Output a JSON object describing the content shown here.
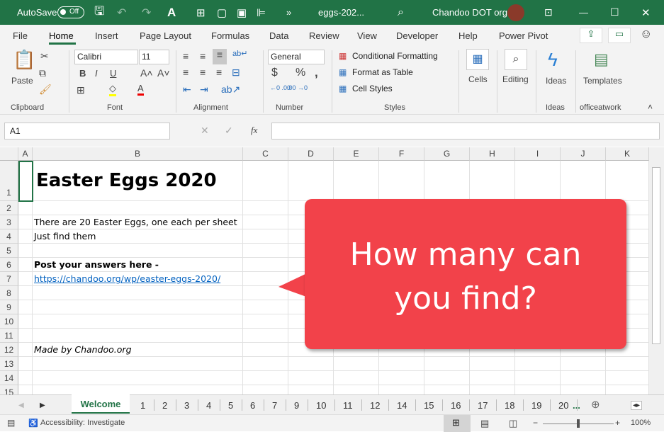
{
  "titlebar": {
    "autosave": "AutoSave",
    "toggle": "Off",
    "filename": "eggs-202...",
    "user": "Chandoo DOT org"
  },
  "menu": [
    "File",
    "Home",
    "Insert",
    "Page Layout",
    "Formulas",
    "Data",
    "Review",
    "View",
    "Developer",
    "Help",
    "Power Pivot"
  ],
  "ribbon": {
    "paste": "Paste",
    "font": "Calibri",
    "size": "11",
    "number_format": "General",
    "cond": "Conditional Formatting",
    "table": "Format as Table",
    "styles": "Cell Styles",
    "cells": "Cells",
    "editing": "Editing",
    "ideas": "Ideas",
    "templates": "Templates",
    "groups": [
      "Clipboard",
      "Font",
      "Alignment",
      "Number",
      "Styles",
      "Ideas",
      "officeatwork"
    ]
  },
  "formula": {
    "namebox": "A1",
    "fx": "fx",
    "value": ""
  },
  "columns": [
    "A",
    "B",
    "C",
    "D",
    "E",
    "F",
    "G",
    "H",
    "I",
    "J",
    "K"
  ],
  "rows": [
    "1",
    "2",
    "3",
    "4",
    "5",
    "6",
    "7",
    "8",
    "9",
    "10",
    "11",
    "12",
    "13",
    "14",
    "15"
  ],
  "cells": {
    "b1": "Easter Eggs 2020",
    "b3": "There are 20 Easter Eggs, one each per sheet",
    "b4": "Just find them",
    "b6": "Post your answers here -",
    "b7": "https://chandoo.org/wp/easter-eggs-2020/",
    "b12": "Made by Chandoo.org"
  },
  "callout": {
    "line1": "How many can",
    "line2": "you find?",
    "color": "#f2424a"
  },
  "sheets": {
    "active": "Welcome",
    "tabs": [
      "1",
      "2",
      "3",
      "4",
      "5",
      "6",
      "7",
      "9",
      "10",
      "11",
      "12",
      "14",
      "15",
      "16",
      "17",
      "18",
      "19",
      "20"
    ],
    "more": "..."
  },
  "status": {
    "accessibility": "Accessibility: Investigate",
    "zoom": "100%",
    "zoom_fraction": 0.5
  },
  "accent": "#217346"
}
